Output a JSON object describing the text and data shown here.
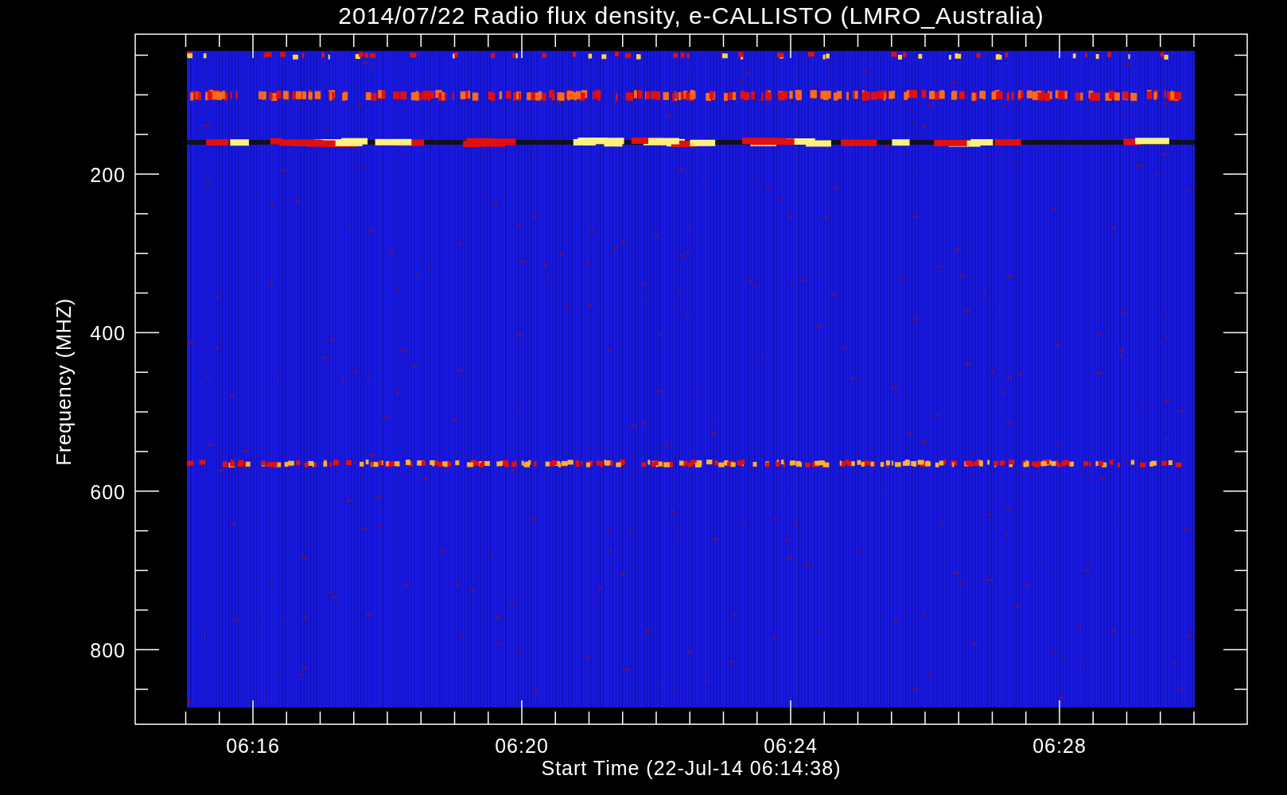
{
  "title": "2014/07/22  Radio flux density, e-CALLISTO (LMRO_Australia)",
  "y_axis": {
    "label": "Frequency (MHZ)",
    "ticks": [
      "200",
      "400",
      "600",
      "800"
    ]
  },
  "x_axis": {
    "label": "Start Time (22-Jul-14 06:14:38)",
    "ticks": [
      "06:16",
      "06:20",
      "06:24",
      "06:28"
    ]
  }
}
